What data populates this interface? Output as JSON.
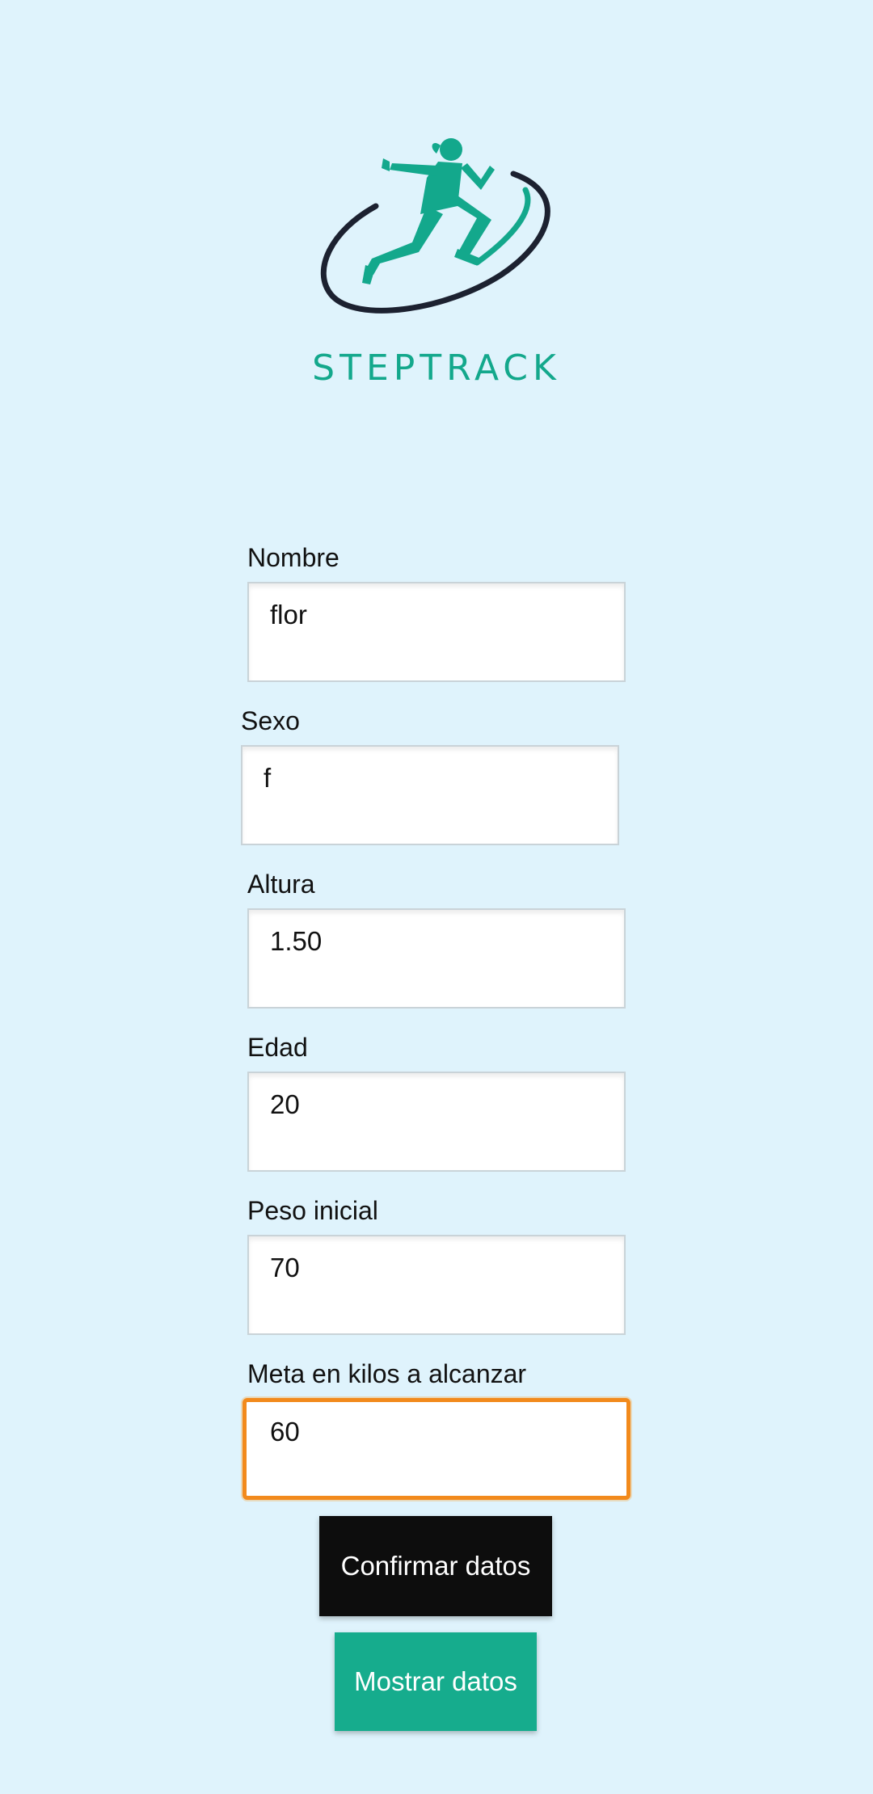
{
  "brand": {
    "name": "STEPTRACK",
    "logo_icon": "runner-orbit-logo-icon",
    "primary_color": "#13a88c",
    "dark_color": "#1c2130"
  },
  "form": {
    "nombre": {
      "label": "Nombre",
      "value": "flor"
    },
    "sexo": {
      "label": "Sexo",
      "value": "f"
    },
    "altura": {
      "label": "Altura",
      "value": "1.50"
    },
    "edad": {
      "label": "Edad",
      "value": "20"
    },
    "peso_inicial": {
      "label": "Peso inicial",
      "value": "70"
    },
    "meta": {
      "label": "Meta en kilos a alcanzar",
      "value": "60"
    }
  },
  "buttons": {
    "confirm_label": "Confirmar datos",
    "show_label": "Mostrar datos"
  },
  "colors": {
    "background": "#dff3fc",
    "focus_border": "#f28a1c",
    "confirm_button": "#0d0d0d",
    "show_button": "#16ac8d"
  }
}
